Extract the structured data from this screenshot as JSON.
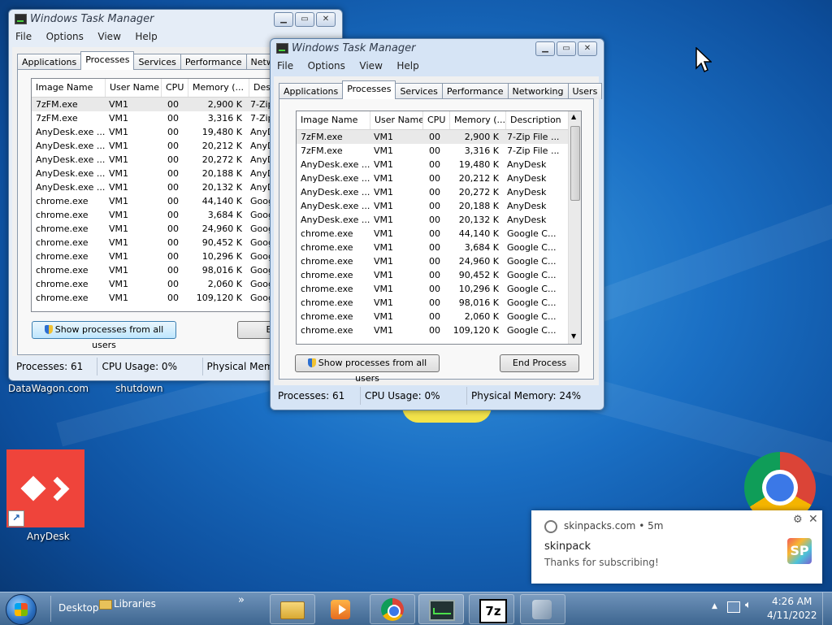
{
  "desktop": {
    "labels": {
      "datawagon": "DataWagon.com",
      "shutdown": "shutdown",
      "anydesk": "AnyDesk"
    }
  },
  "back_window": {
    "title": "Windows Task Manager",
    "menu": [
      "File",
      "Options",
      "View",
      "Help"
    ],
    "tabs": [
      "Applications",
      "Processes",
      "Services",
      "Performance",
      "Networkin"
    ],
    "columns": [
      "Image Name",
      "User Name",
      "CPU",
      "Memory (...",
      "Descrip"
    ],
    "rows": [
      [
        "7zFM.exe",
        "VM1",
        "00",
        "2,900 K",
        "7-Zip"
      ],
      [
        "7zFM.exe",
        "VM1",
        "00",
        "3,316 K",
        "7-Zip"
      ],
      [
        "AnyDesk.exe ...",
        "VM1",
        "00",
        "19,480 K",
        "AnyD"
      ],
      [
        "AnyDesk.exe ...",
        "VM1",
        "00",
        "20,212 K",
        "AnyD"
      ],
      [
        "AnyDesk.exe ...",
        "VM1",
        "00",
        "20,272 K",
        "AnyD"
      ],
      [
        "AnyDesk.exe ...",
        "VM1",
        "00",
        "20,188 K",
        "AnyD"
      ],
      [
        "AnyDesk.exe ...",
        "VM1",
        "00",
        "20,132 K",
        "AnyD"
      ],
      [
        "chrome.exe",
        "VM1",
        "00",
        "44,140 K",
        "Googl"
      ],
      [
        "chrome.exe",
        "VM1",
        "00",
        "3,684 K",
        "Googl"
      ],
      [
        "chrome.exe",
        "VM1",
        "00",
        "24,960 K",
        "Googl"
      ],
      [
        "chrome.exe",
        "VM1",
        "00",
        "90,452 K",
        "Googl"
      ],
      [
        "chrome.exe",
        "VM1",
        "00",
        "10,296 K",
        "Googl"
      ],
      [
        "chrome.exe",
        "VM1",
        "00",
        "98,016 K",
        "Googl"
      ],
      [
        "chrome.exe",
        "VM1",
        "00",
        "2,060 K",
        "Googl"
      ],
      [
        "chrome.exe",
        "VM1",
        "00",
        "109,120 K",
        "Googl"
      ]
    ],
    "show_all_label": "Show processes from all users",
    "end_label": "End",
    "status": [
      "Processes: 61",
      "CPU Usage: 0%",
      "Physical Mem"
    ]
  },
  "front_window": {
    "title": "Windows Task Manager",
    "menu": [
      "File",
      "Options",
      "View",
      "Help"
    ],
    "tabs": [
      "Applications",
      "Processes",
      "Services",
      "Performance",
      "Networking",
      "Users"
    ],
    "columns": [
      "Image Name",
      "User Name",
      "CPU",
      "Memory (...",
      "Description"
    ],
    "rows": [
      [
        "7zFM.exe",
        "VM1",
        "00",
        "2,900 K",
        "7-Zip File ..."
      ],
      [
        "7zFM.exe",
        "VM1",
        "00",
        "3,316 K",
        "7-Zip File ..."
      ],
      [
        "AnyDesk.exe ...",
        "VM1",
        "00",
        "19,480 K",
        "AnyDesk"
      ],
      [
        "AnyDesk.exe ...",
        "VM1",
        "00",
        "20,212 K",
        "AnyDesk"
      ],
      [
        "AnyDesk.exe ...",
        "VM1",
        "00",
        "20,272 K",
        "AnyDesk"
      ],
      [
        "AnyDesk.exe ...",
        "VM1",
        "00",
        "20,188 K",
        "AnyDesk"
      ],
      [
        "AnyDesk.exe ...",
        "VM1",
        "00",
        "20,132 K",
        "AnyDesk"
      ],
      [
        "chrome.exe",
        "VM1",
        "00",
        "44,140 K",
        "Google C..."
      ],
      [
        "chrome.exe",
        "VM1",
        "00",
        "3,684 K",
        "Google C..."
      ],
      [
        "chrome.exe",
        "VM1",
        "00",
        "24,960 K",
        "Google C..."
      ],
      [
        "chrome.exe",
        "VM1",
        "00",
        "90,452 K",
        "Google C..."
      ],
      [
        "chrome.exe",
        "VM1",
        "00",
        "10,296 K",
        "Google C..."
      ],
      [
        "chrome.exe",
        "VM1",
        "00",
        "98,016 K",
        "Google C..."
      ],
      [
        "chrome.exe",
        "VM1",
        "00",
        "2,060 K",
        "Google C..."
      ],
      [
        "chrome.exe",
        "VM1",
        "00",
        "109,120 K",
        "Google C..."
      ]
    ],
    "show_all_label": "Show processes from all users",
    "end_label": "End Process",
    "status": [
      "Processes: 61",
      "CPU Usage: 0%",
      "Physical Memory: 24%"
    ]
  },
  "notification": {
    "source": "skinpacks.com",
    "time": "5m",
    "title": "skinpack",
    "body": "Thanks for subscribing!",
    "logo_text": "SP"
  },
  "taskbar": {
    "desktop_label": "Desktop",
    "libraries_label": "Libraries",
    "overflow": "»",
    "clock_time": "4:26 AM",
    "clock_date": "4/11/2022",
    "sevenzip_label": "7z"
  },
  "colors": {
    "accent": "#3c7fb1",
    "anydesk": "#ef443b"
  }
}
